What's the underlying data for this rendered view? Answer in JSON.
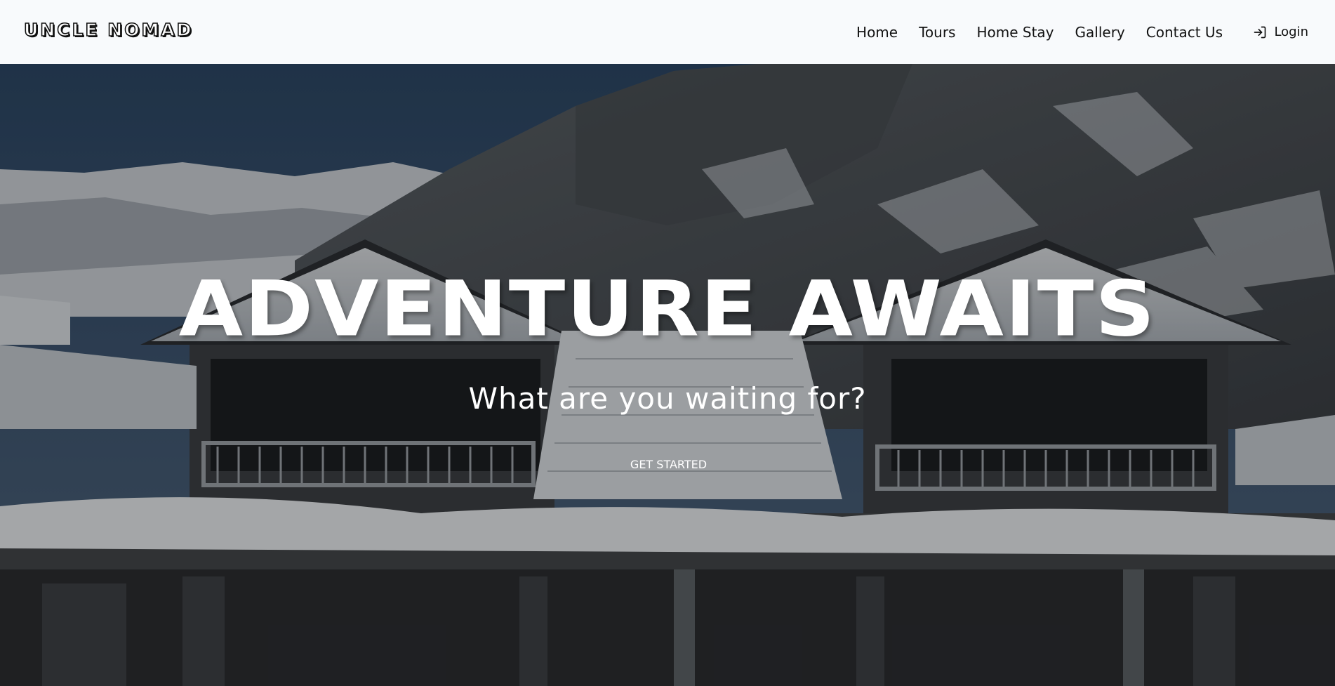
{
  "brand": {
    "logo_text": "UNCLE NOMAD"
  },
  "nav": {
    "links": [
      {
        "label": "Home"
      },
      {
        "label": "Tours"
      },
      {
        "label": "Home Stay"
      },
      {
        "label": "Gallery"
      },
      {
        "label": "Contact Us"
      }
    ],
    "login": {
      "label": "Login",
      "icon": "login-icon"
    }
  },
  "hero": {
    "title": "ADVENTURE AWAITS",
    "subtitle": "What are you waiting for?",
    "cta_label": "GET STARTED",
    "background": "snowy-mountain-chalet-photo"
  },
  "colors": {
    "navbar_bg": "#f8fafc",
    "nav_text": "#111111",
    "hero_text": "#ffffff"
  }
}
